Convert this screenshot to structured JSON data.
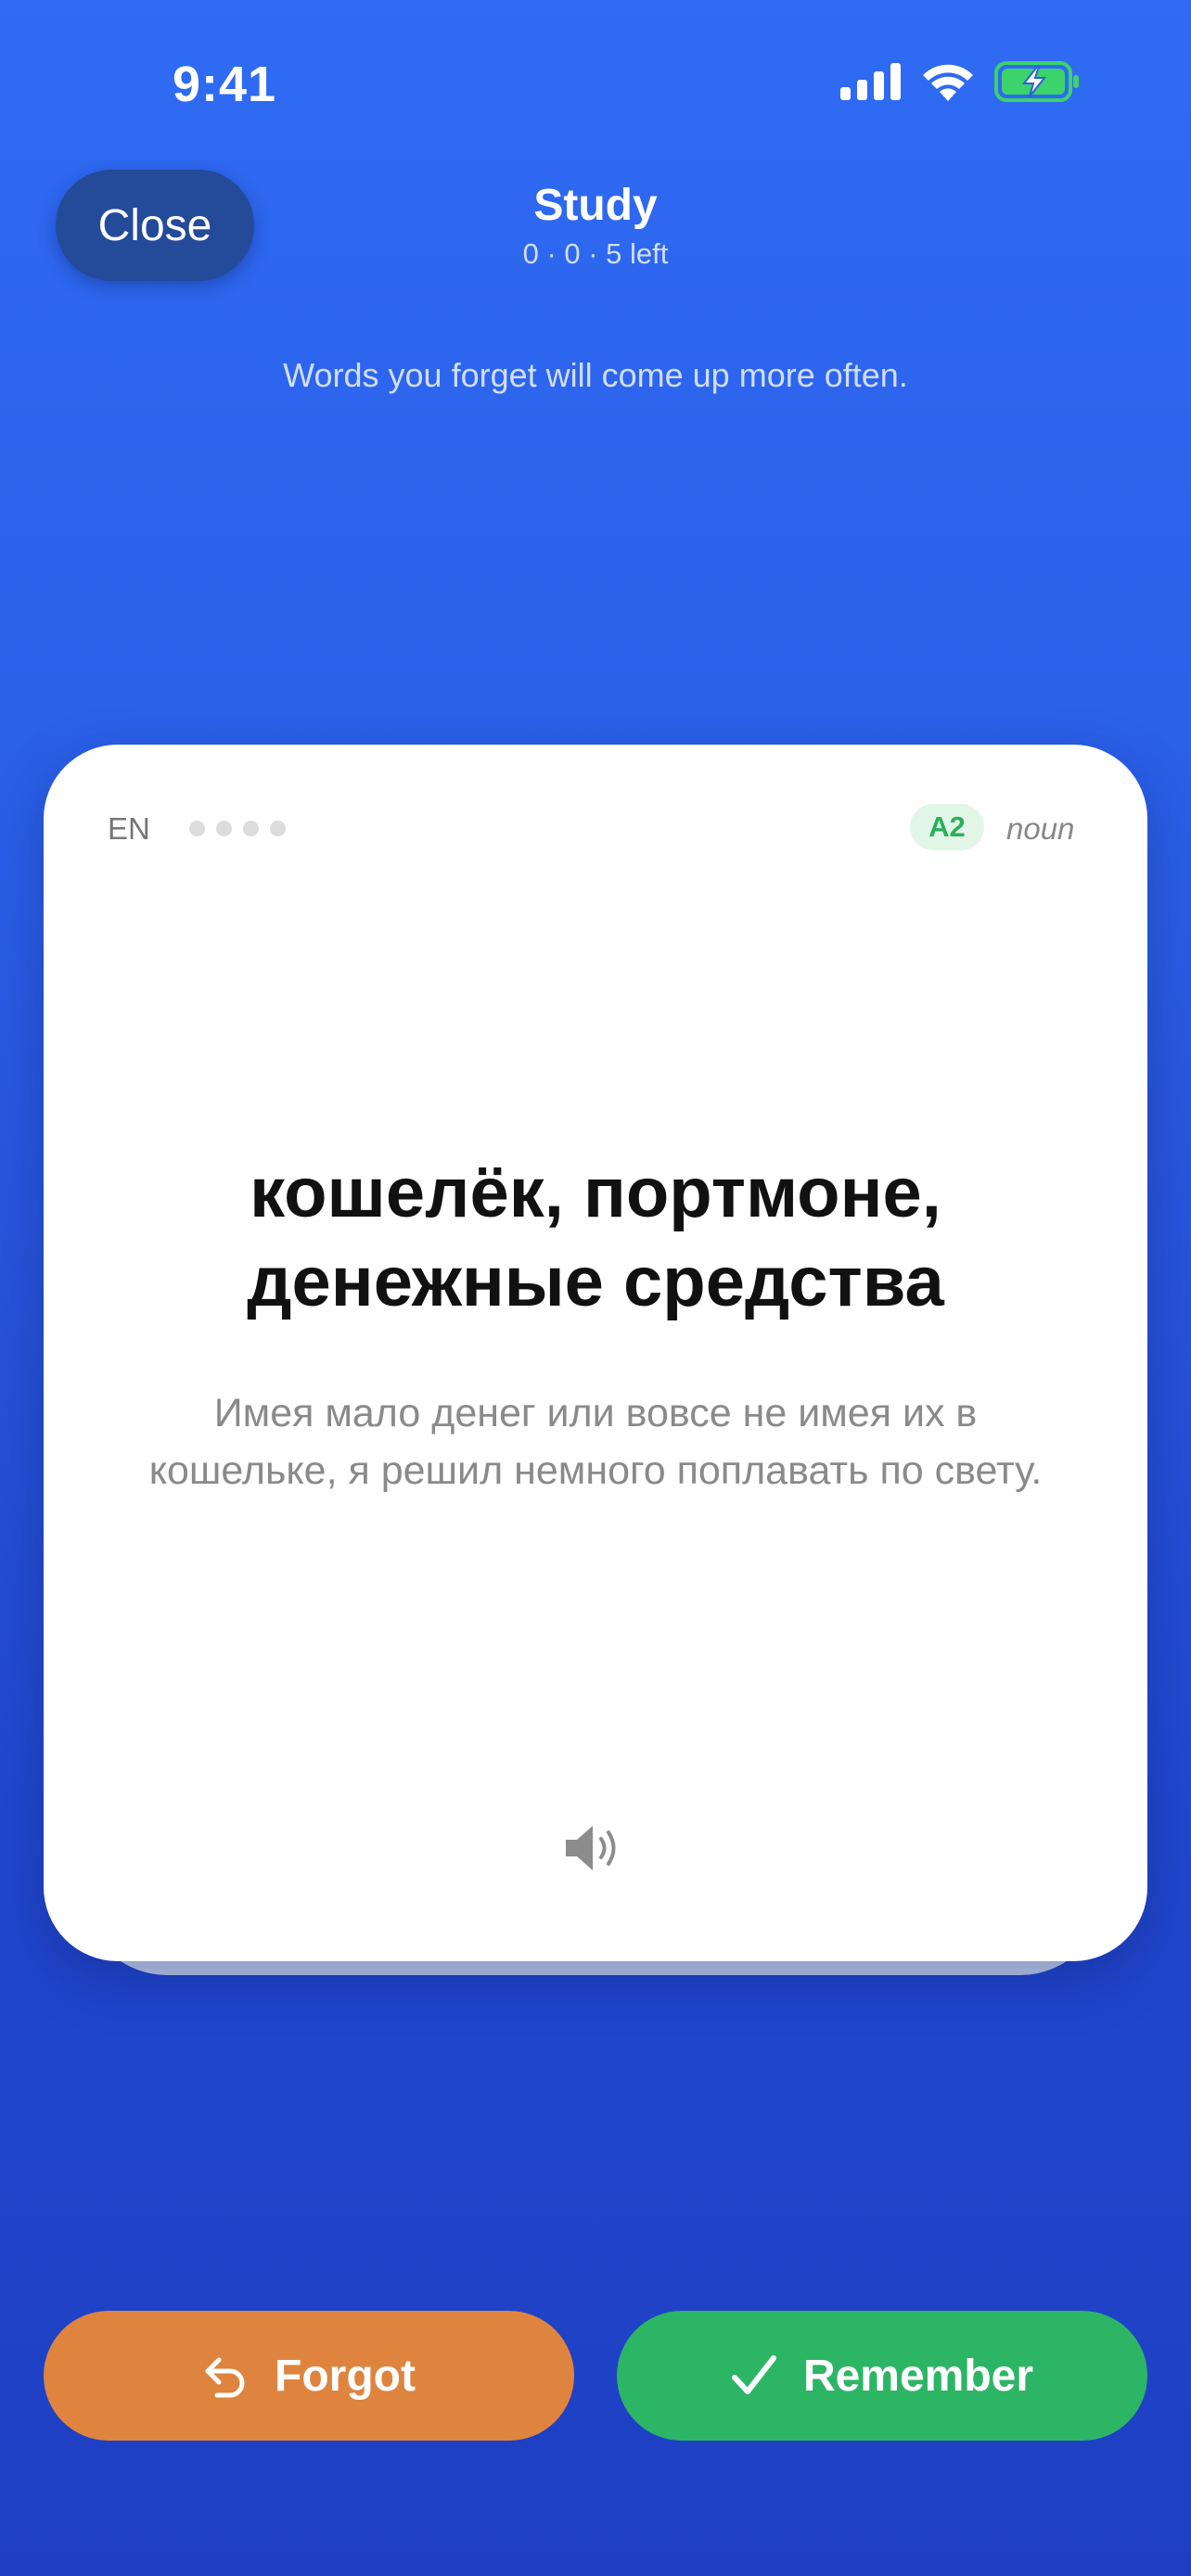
{
  "status_bar": {
    "time": "9:41",
    "icons": [
      "cellular-signal-icon",
      "wifi-icon",
      "battery-charging-icon"
    ]
  },
  "header": {
    "close_label": "Close",
    "title": "Study",
    "subtitle": "0 · 0 · 5 left",
    "hint": "Words you forget will come up more often."
  },
  "card": {
    "language": "EN",
    "level": "A2",
    "part_of_speech": "noun",
    "word_line1": "кошелёк, портмоне,",
    "word_line2": "денежные средства",
    "example": "Имея мало денег или вовсе не имея их в кошельке, я решил немного поплавать по свету.",
    "audio_icon": "speaker-icon"
  },
  "actions": {
    "forgot_label": "Forgot",
    "forgot_icon": "undo-arrow-icon",
    "remember_label": "Remember",
    "remember_icon": "checkmark-icon"
  },
  "colors": {
    "background_top": "#2f6bf3",
    "background_bottom": "#1e3fc2",
    "forgot": "#de843f",
    "remember": "#2db566",
    "level_badge": "#29b05a"
  }
}
